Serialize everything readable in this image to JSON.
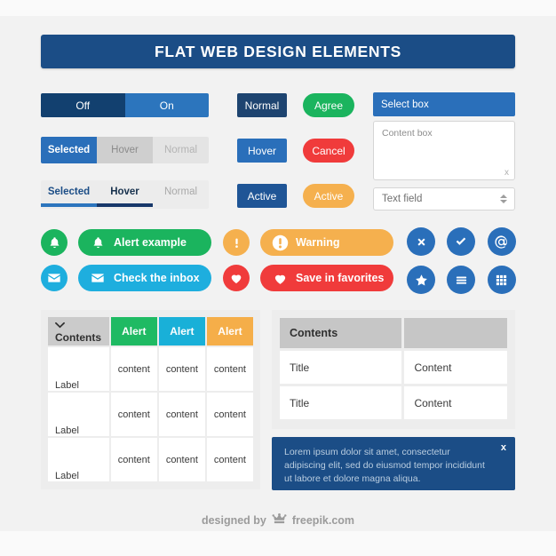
{
  "header": {
    "title": "FLAT WEB DESIGN ELEMENTS"
  },
  "toggle_onoff": {
    "off_label": "Off",
    "on_label": "On"
  },
  "tabs_filled": {
    "selected": "Selected",
    "hover": "Hover",
    "normal": "Normal"
  },
  "tabs_underline": {
    "selected": "Selected",
    "hover": "Hover",
    "normal": "Normal"
  },
  "square_buttons": {
    "normal": "Normal",
    "hover": "Hover",
    "active": "Active"
  },
  "pill_buttons": {
    "agree": "Agree",
    "cancel": "Cancel",
    "active": "Active"
  },
  "form": {
    "select_box": "Select box",
    "content_box": "Content box",
    "content_box_handle": "x",
    "text_field": "Text field"
  },
  "alert_bars": {
    "alert_example": "Alert example",
    "check_inbox": "Check the inbox",
    "warning": "Warning",
    "save_favorites": "Save in favorites"
  },
  "icons": {
    "bell": "bell-icon",
    "mail": "envelope-icon",
    "warning": "exclamation-icon",
    "heart": "heart-icon",
    "close": "x-icon",
    "check": "check-icon",
    "at": "at-icon",
    "star": "star-icon",
    "menu": "hamburger-menu-icon",
    "grid": "grid-icon"
  },
  "table_left": {
    "headers": [
      "Contents",
      "Alert",
      "Alert",
      "Alert"
    ],
    "header_colors": [
      "#cbcbcb",
      "#1fba63",
      "#19b0d8",
      "#f5ae49"
    ],
    "rows": [
      [
        "Label",
        "content",
        "content",
        "content"
      ],
      [
        "Label",
        "content",
        "content",
        "content"
      ],
      [
        "Label",
        "content",
        "content",
        "content"
      ]
    ]
  },
  "table_right": {
    "headers": [
      "Contents",
      ""
    ],
    "rows": [
      [
        "Title",
        "Content"
      ],
      [
        "Title",
        "Content"
      ]
    ]
  },
  "alert_box": {
    "text": "Lorem ipsum dolor sit amet, consectetur adipiscing elit, sed do eiusmod tempor incididunt ut labore et dolore magna aliqua.",
    "close": "x"
  },
  "footer": {
    "prefix": "designed by",
    "brand": "freepik.com"
  },
  "colors": {
    "navy": "#1b4d86",
    "blue": "#2a6fba",
    "dark_navy": "#12406f",
    "green": "#1bb45e",
    "cyan": "#1eaede",
    "orange": "#f5b04e",
    "red": "#f03b3b",
    "background": "#f2f2f2"
  }
}
